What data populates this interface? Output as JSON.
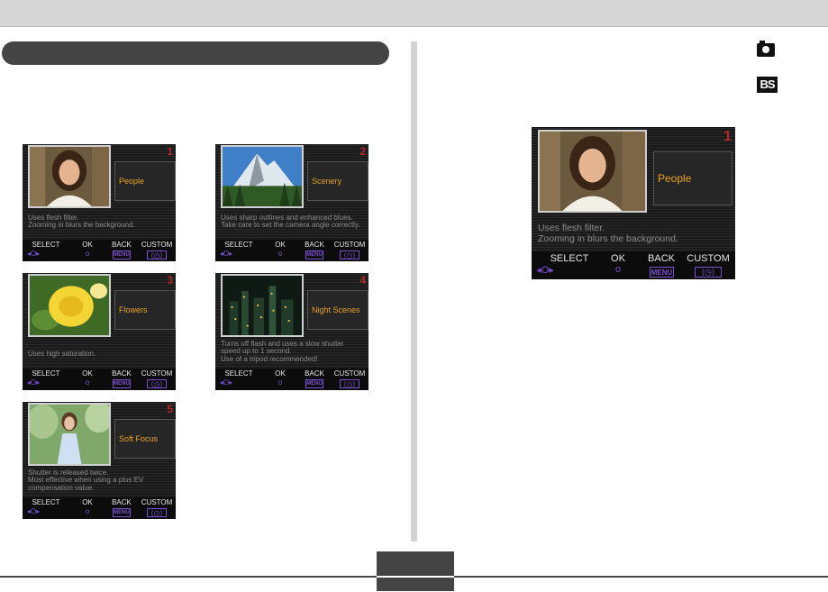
{
  "bottom_bar": {
    "select_label": "SELECT",
    "select_icon": "◂O▸",
    "ok_label": "OK",
    "ok_icon": "o",
    "back_label": "BACK",
    "back_icon": "MENU",
    "custom_label": "CUSTOM",
    "custom_icon": "⟨◷⟩"
  },
  "mode_icons": {
    "camera": "camera-icon",
    "bestshot": "BS"
  },
  "scenes": [
    {
      "number": "1",
      "name": "People",
      "desc1": "Uses flesh filter.",
      "desc2": "Zooming in blurs the background.",
      "desc3": ""
    },
    {
      "number": "2",
      "name": "Scenery",
      "desc1": "Uses sharp outlines and enhanced blues.",
      "desc2": "Take care to set the camera angle correctly.",
      "desc3": ""
    },
    {
      "number": "3",
      "name": "Flowers",
      "desc1": "Uses high saturation.",
      "desc2": "",
      "desc3": ""
    },
    {
      "number": "4",
      "name": "Night Scenes",
      "desc1": "Turns off flash and uses a slow shutter",
      "desc2": "speed up to 1 second.",
      "desc3": "Use of a tripod recommended!"
    },
    {
      "number": "5",
      "name": "Soft Focus",
      "desc1": "Shutter is released twice.",
      "desc2": "Most effective when using a plus EV",
      "desc3": "compensation value."
    }
  ],
  "big_screen": {
    "number": "1",
    "name": "People",
    "desc1": "Uses flesh filter.",
    "desc2": "Zooming in blurs the background."
  },
  "colors": {
    "accent_orange": "#e9a21e",
    "number_red": "#b02a28",
    "icon_purple": "#7a4fd0",
    "dark_gray": "#444444"
  }
}
